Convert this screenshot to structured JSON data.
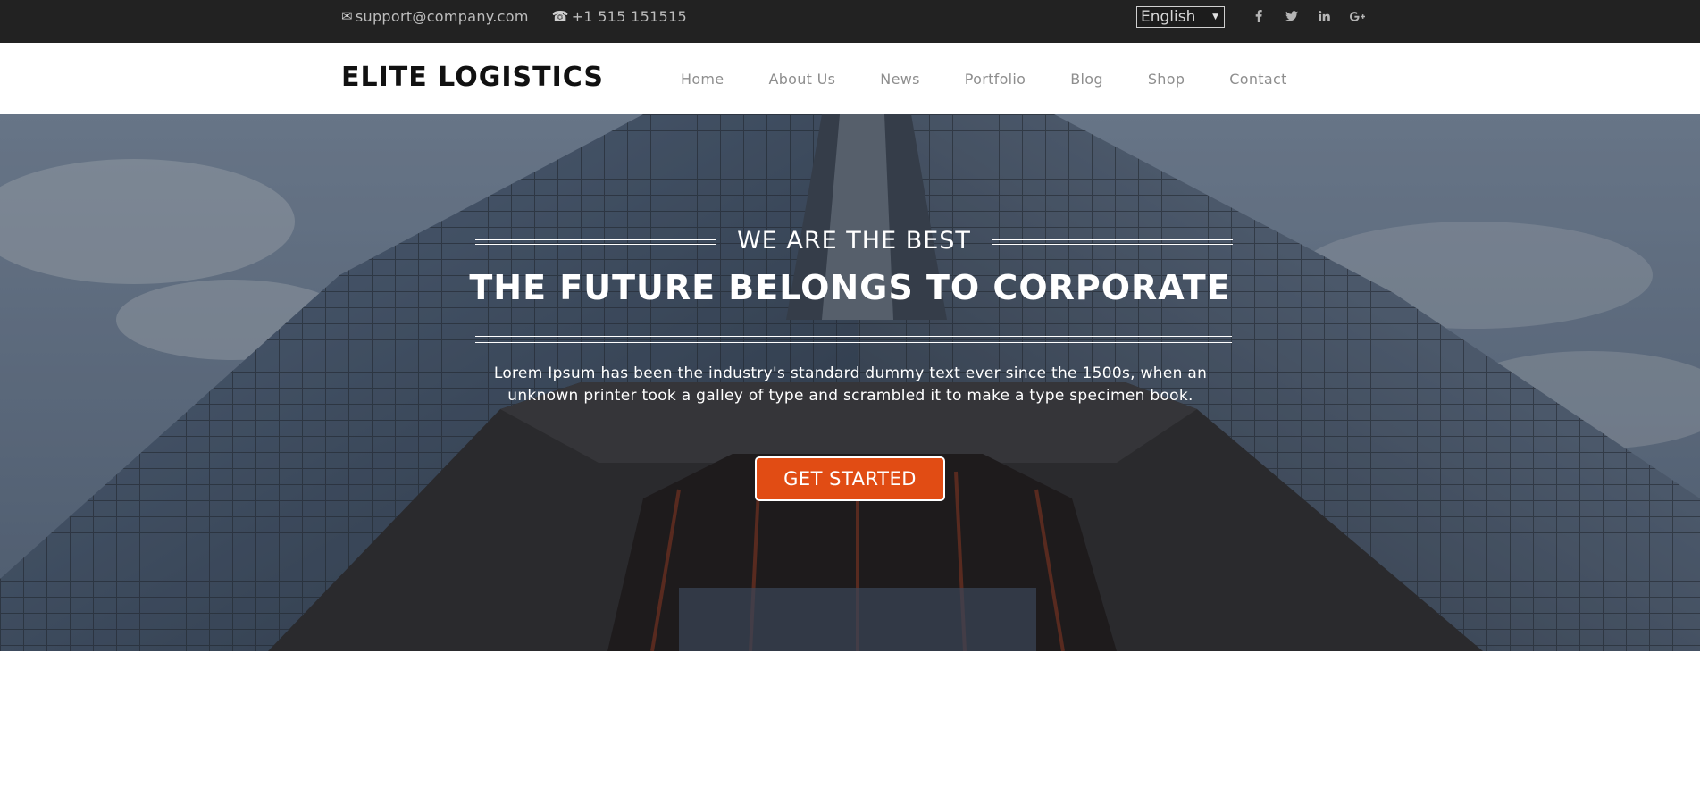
{
  "topbar": {
    "email": "support@company.com",
    "phone": "+1 515 151515",
    "email_icon": "envelope-icon",
    "phone_icon": "phone-icon",
    "language": "English",
    "social_icons": [
      "facebook-icon",
      "twitter-icon",
      "linkedin-icon",
      "google-plus-icon"
    ]
  },
  "header": {
    "logo": "ELITE LOGISTICS",
    "nav": [
      "Home",
      "About Us",
      "News",
      "Portfolio",
      "Blog",
      "Shop",
      "Contact"
    ]
  },
  "hero": {
    "eyebrow": "WE ARE THE BEST",
    "headline": "THE FUTURE BELONGS TO CORPORATE",
    "description": "Lorem Ipsum has been the industry's standard dummy text ever since the 1500s, when an unknown printer took a galley of type and scrambled it to make a type specimen book.",
    "cta_label": "GET STARTED"
  },
  "colors": {
    "topbar_bg": "#222222",
    "accent": "#e14c14",
    "nav_text": "#8e8e8e"
  }
}
